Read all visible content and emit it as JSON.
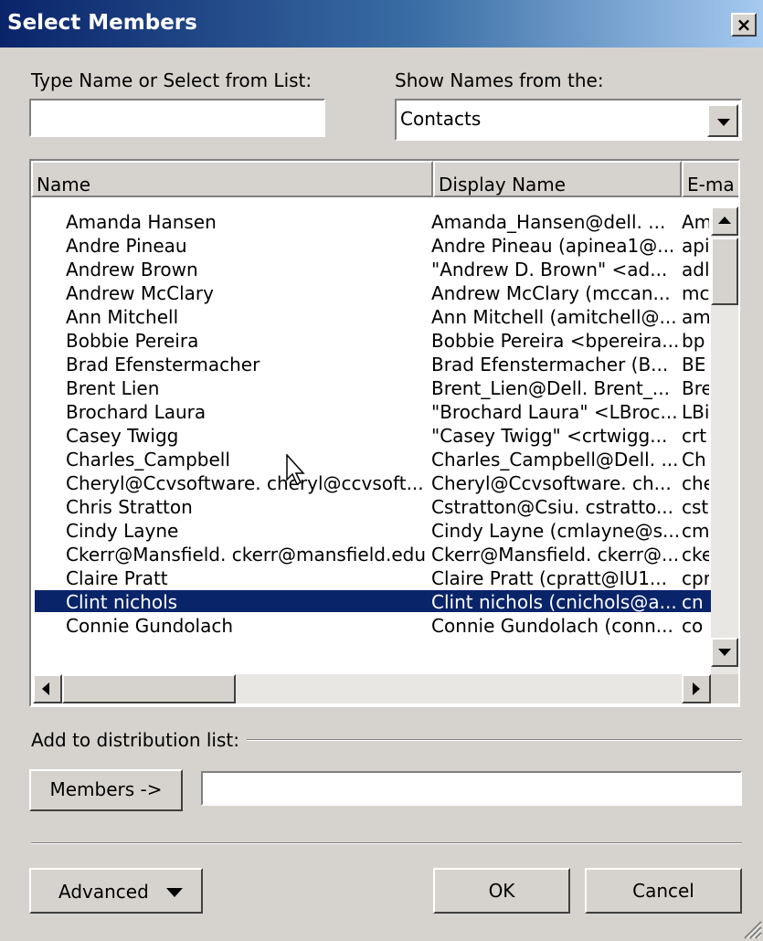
{
  "window": {
    "title": "Select Members",
    "close_label": "×"
  },
  "search": {
    "label": "Type Name or Select from List:",
    "value": ""
  },
  "address_book": {
    "label": "Show Names from the:",
    "selected": "Contacts"
  },
  "table": {
    "columns": [
      "Name",
      "Display Name",
      "E-ma"
    ],
    "rows": [
      {
        "name": "Amanda Hansen",
        "display": "Amanda_Hansen@dell. ...",
        "email": "Am"
      },
      {
        "name": "Andre Pineau",
        "display": "Andre Pineau (apinea1@...",
        "email": "api"
      },
      {
        "name": "Andrew Brown",
        "display": "\"Andrew D. Brown\" <ad...",
        "email": "adl"
      },
      {
        "name": "Andrew McClary",
        "display": "Andrew McClary (mccan...",
        "email": "mc"
      },
      {
        "name": "Ann Mitchell",
        "display": "Ann Mitchell (amitchell@...",
        "email": "am"
      },
      {
        "name": "Bobbie Pereira",
        "display": "Bobbie Pereira <bpereira...",
        "email": "bp"
      },
      {
        "name": "Brad Efenstermacher",
        "display": "Brad Efenstermacher (B...",
        "email": "BE"
      },
      {
        "name": "Brent Lien",
        "display": "Brent_Lien@Dell. Brent_...",
        "email": "Bre"
      },
      {
        "name": "Brochard Laura",
        "display": "\"Brochard Laura\" <LBroc...",
        "email": "LBi"
      },
      {
        "name": "Casey Twigg",
        "display": "\"Casey Twigg\" <crtwigg...",
        "email": "crt"
      },
      {
        "name": "Charles_Campbell",
        "display": "Charles_Campbell@Dell. ...",
        "email": "Ch"
      },
      {
        "name": "Cheryl@Ccvsoftware. cheryl@ccvsoft...",
        "display": "Cheryl@Ccvsoftware. ch...",
        "email": "che"
      },
      {
        "name": "Chris Stratton",
        "display": "Cstratton@Csiu. cstratto...",
        "email": "cst"
      },
      {
        "name": "Cindy Layne",
        "display": "Cindy Layne (cmlayne@s...",
        "email": "cm"
      },
      {
        "name": "Ckerr@Mansfield. ckerr@mansfield.edu",
        "display": "Ckerr@Mansfield. ckerr@...",
        "email": "cke"
      },
      {
        "name": "Claire Pratt",
        "display": "Claire Pratt (cpratt@IU1...",
        "email": "cpr"
      },
      {
        "name": "Clint nichols",
        "display": "Clint nichols (cnichols@a...",
        "email": "cn",
        "selected": true
      },
      {
        "name": "Connie Gundolach",
        "display": "Connie Gundolach (conn...",
        "email": "co"
      }
    ]
  },
  "distribution": {
    "label": "Add to distribution list:",
    "members_button": "Members ->",
    "members_value": ""
  },
  "footer": {
    "advanced_label": "Advanced",
    "ok_label": "OK",
    "cancel_label": "Cancel"
  },
  "colors": {
    "title_start": "#0a246a",
    "title_end": "#a6caf0",
    "selection": "#0a246a",
    "face": "#d6d3ce"
  }
}
